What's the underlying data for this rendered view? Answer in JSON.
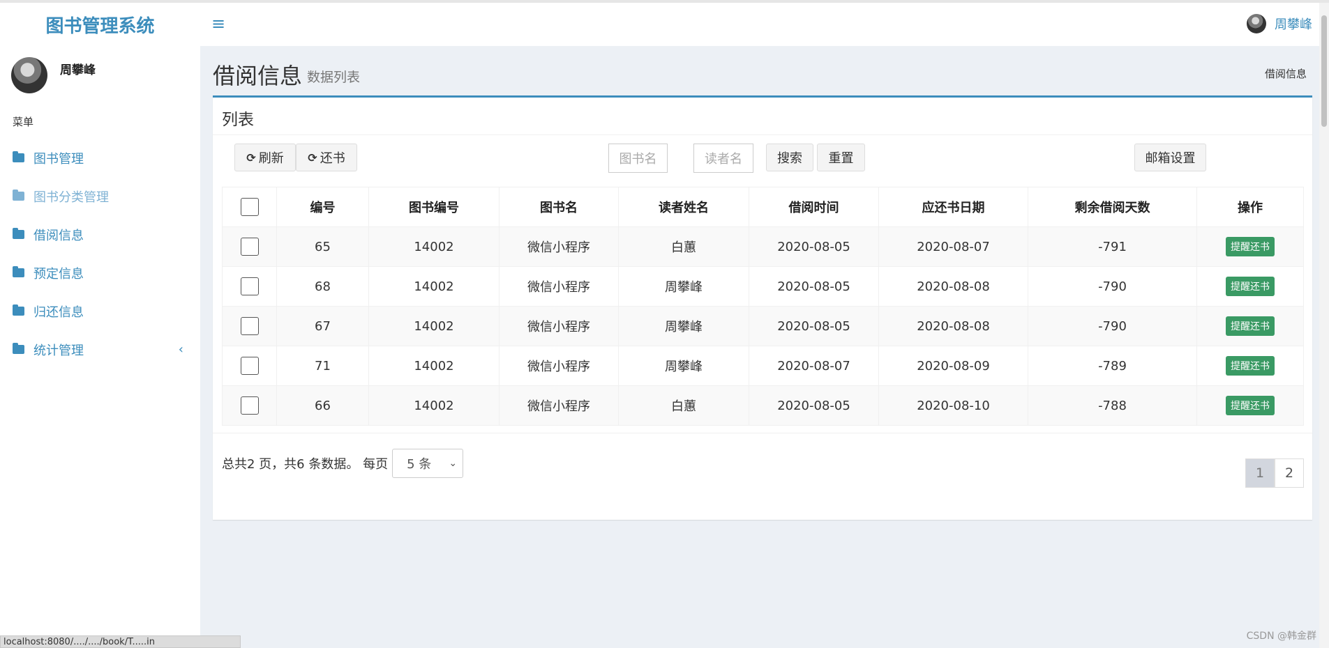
{
  "app": {
    "title": "图书管理系统",
    "user_name": "周攀峰"
  },
  "sidebar": {
    "menu_header": "菜单",
    "items": [
      {
        "label": "图书管理",
        "icon": "folder-icon"
      },
      {
        "label": "图书分类管理",
        "icon": "folder-icon"
      },
      {
        "label": "借阅信息",
        "icon": "folder-icon"
      },
      {
        "label": "预定信息",
        "icon": "folder-icon"
      },
      {
        "label": "归还信息",
        "icon": "folder-icon"
      },
      {
        "label": "统计管理",
        "icon": "folder-icon"
      }
    ],
    "status_url": "localhost:8080/..../..../book/T.....in"
  },
  "header": {
    "menu_icon": "hamburger-icon",
    "user_name": "周攀峰"
  },
  "page": {
    "title": "借阅信息",
    "subtitle": "数据列表",
    "breadcrumb": "借阅信息"
  },
  "box": {
    "title": "列表",
    "toolbar": {
      "refresh_label": "刷新",
      "return_label": "还书",
      "book_name_placeholder": "图书名",
      "reader_name_placeholder": "读者名",
      "search_label": "搜索",
      "reset_label": "重置",
      "mail_settings_label": "邮箱设置"
    },
    "table": {
      "headers": [
        "编号",
        "图书编号",
        "图书名",
        "读者姓名",
        "借阅时间",
        "应还书日期",
        "剩余借阅天数",
        "操作"
      ],
      "rows": [
        {
          "id": "65",
          "book_no": "14002",
          "book_name": "微信小程序",
          "reader": "白蕙",
          "borrow_date": "2020-08-05",
          "due_date": "2020-08-07",
          "days_left": "-791",
          "action": "提醒还书"
        },
        {
          "id": "68",
          "book_no": "14002",
          "book_name": "微信小程序",
          "reader": "周攀峰",
          "borrow_date": "2020-08-05",
          "due_date": "2020-08-08",
          "days_left": "-790",
          "action": "提醒还书"
        },
        {
          "id": "67",
          "book_no": "14002",
          "book_name": "微信小程序",
          "reader": "周攀峰",
          "borrow_date": "2020-08-05",
          "due_date": "2020-08-08",
          "days_left": "-790",
          "action": "提醒还书"
        },
        {
          "id": "71",
          "book_no": "14002",
          "book_name": "微信小程序",
          "reader": "周攀峰",
          "borrow_date": "2020-08-07",
          "due_date": "2020-08-09",
          "days_left": "-789",
          "action": "提醒还书"
        },
        {
          "id": "66",
          "book_no": "14002",
          "book_name": "微信小程序",
          "reader": "白蕙",
          "borrow_date": "2020-08-05",
          "due_date": "2020-08-10",
          "days_left": "-788",
          "action": "提醒还书"
        }
      ]
    },
    "pagination": {
      "info": "总共2 页，共6 条数据。 每页",
      "page_size": "5 条",
      "pages": [
        "1",
        "2"
      ],
      "current": "1"
    }
  },
  "watermark": "CSDN @韩金群"
}
